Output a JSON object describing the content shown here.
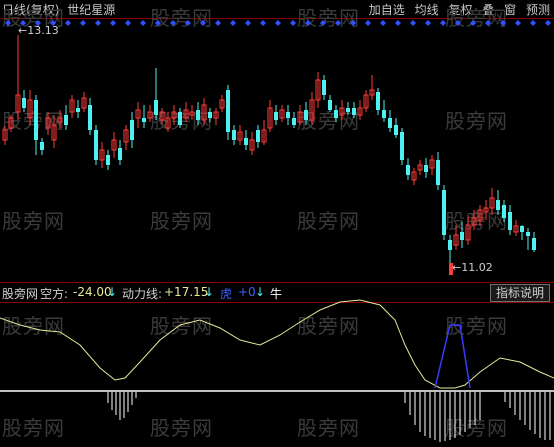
{
  "toolbar": {
    "period": "日线",
    "adjust": "(复权)",
    "stock_name": "世纪星源",
    "buttons": [
      "加自选",
      "均线",
      "复权",
      "叠",
      "窗",
      "预测"
    ]
  },
  "watermark": "股旁网",
  "price_labels": {
    "high": "13.13",
    "low": "11.02"
  },
  "indicator": {
    "name": "股旁网",
    "kong_label": "空方:",
    "kong_value": "-24.00",
    "dongli_label": "动力线:",
    "dongli_value": "+17.15",
    "hu_label": "虎",
    "hu_value": "+0",
    "niu_label": "牛",
    "help_button": "指标说明"
  },
  "colors": {
    "up": "#ff3a3a",
    "down": "#4ff0f0",
    "signal": "#3a3aff",
    "line": "#e8e89a",
    "hist": "#ffffff",
    "diamond": "#3050ff"
  }
}
